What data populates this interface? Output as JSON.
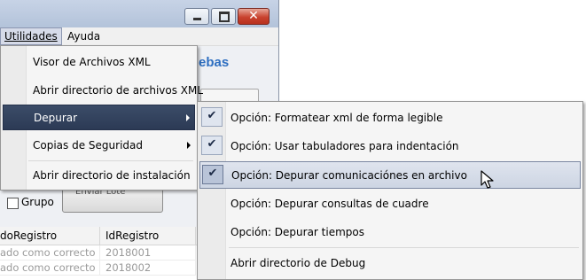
{
  "menubar": {
    "utilidades": "Utilidades",
    "ayuda": "Ayuda"
  },
  "window": {
    "brand_partial": "ebas",
    "action_button_partial": "Enviar Lote"
  },
  "grupo": {
    "label": "Grupo",
    "checked": false
  },
  "grid": {
    "columns": [
      "doRegistro",
      "IdRegistro"
    ],
    "rows": [
      {
        "estado": "ado como correcto",
        "id": "2018001"
      },
      {
        "estado": "ado como correcto",
        "id": "2018002"
      }
    ]
  },
  "utilidades_menu": {
    "items": [
      {
        "label": "Visor de Archivos XML",
        "submenu": false
      },
      {
        "label": "Abrir directorio de archivos XML",
        "submenu": false
      },
      {
        "label": "Depurar",
        "submenu": true,
        "highlighted": true
      },
      {
        "label": "Copias de Seguridad",
        "submenu": true
      },
      {
        "label": "Abrir directorio de instalación",
        "submenu": false
      }
    ]
  },
  "depurar_submenu": {
    "items": [
      {
        "label": "Opción: Formatear xml de forma legible",
        "checked": true
      },
      {
        "label": "Opción: Usar tabuladores para indentación",
        "checked": true
      },
      {
        "label": "Opción: Depurar comunicaciónes en archivo",
        "checked": true,
        "hovered": true
      },
      {
        "label": "Opción: Depurar consultas de cuadre",
        "checked": false
      },
      {
        "label": "Opción: Depurar tiempos",
        "checked": false
      },
      {
        "label": "Abrir directorio de Debug",
        "checked": false
      }
    ],
    "check_glyph": "✔"
  },
  "colors": {
    "highlight": "#2f3d59",
    "hover": "#cdd5e3"
  }
}
